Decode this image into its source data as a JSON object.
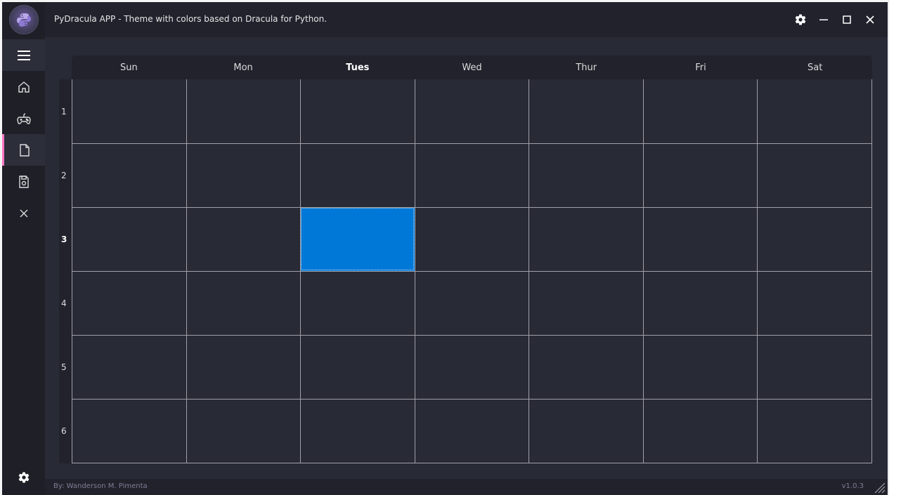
{
  "window": {
    "title": "PyDracula APP - Theme with colors based on Dracula for Python."
  },
  "left_menu": {
    "items": [
      {
        "name": "home",
        "icon": "home-icon"
      },
      {
        "name": "widgets",
        "icon": "gamepad-icon"
      },
      {
        "name": "new",
        "icon": "file-icon",
        "active": true
      },
      {
        "name": "save",
        "icon": "save-icon"
      },
      {
        "name": "exit",
        "icon": "close-icon"
      }
    ]
  },
  "calendar": {
    "days": [
      "Sun",
      "Mon",
      "Tues",
      "Wed",
      "Thur",
      "Fri",
      "Sat"
    ],
    "current_day": "Tues",
    "rows": [
      "1",
      "2",
      "3",
      "4",
      "5",
      "6"
    ],
    "current_row": "3",
    "selected_cell": {
      "row": 3,
      "col": "Tues"
    }
  },
  "footer": {
    "credits": "By: Wanderson M. Pimenta",
    "version": "v1.0.3"
  },
  "colors": {
    "background": "#282a36",
    "menu": "#1e1f27",
    "accent": "#ff79c6",
    "selection": "#0078d7"
  }
}
